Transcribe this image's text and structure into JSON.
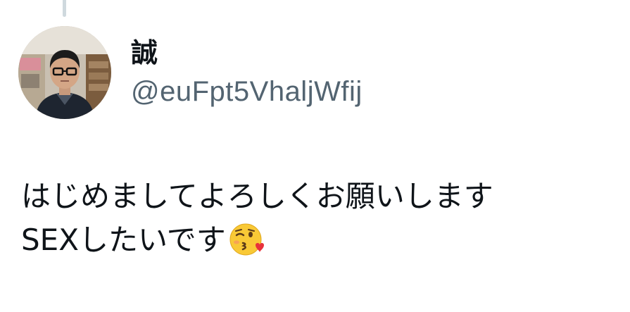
{
  "tweet": {
    "display_name": "誠",
    "handle": "@euFpt5VhaljWfij",
    "text_line1": "はじめましてよろしくお願いします",
    "text_line2": "SEXしたいです",
    "emoji": "kissing-face-with-heart-icon"
  },
  "colors": {
    "text_primary": "#0f1419",
    "text_secondary": "#536471",
    "thread_line": "#cfd9de",
    "background": "#ffffff"
  }
}
